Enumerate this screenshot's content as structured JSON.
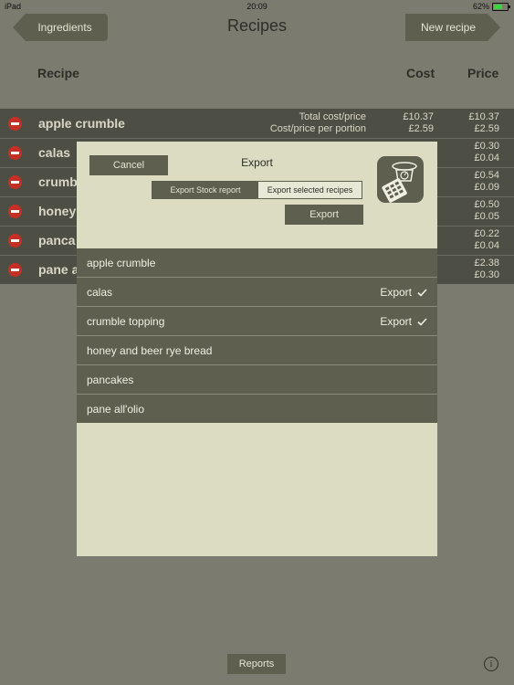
{
  "status": {
    "device": "iPad",
    "time": "20:09",
    "battery": "62%"
  },
  "nav": {
    "back_label": "Ingredients",
    "title": "Recipes",
    "new_label": "New recipe"
  },
  "columns": {
    "recipe": "Recipe",
    "cost": "Cost",
    "price": "Price"
  },
  "summary": {
    "total_label": "Total cost/price",
    "portion_label": "Cost/price per portion",
    "total_cost": "£10.37",
    "total_price": "£10.37",
    "portion_cost": "£2.59",
    "portion_price": "£2.59"
  },
  "rows": [
    {
      "name": "apple crumble",
      "cost1": "",
      "cost2": "",
      "price1": "",
      "price2": ""
    },
    {
      "name": "calas",
      "price1": "£0.30",
      "price2": "£0.04"
    },
    {
      "name": "crumb",
      "price1": "£0.54",
      "price2": "£0.09"
    },
    {
      "name": "honey",
      "price1": "£0.50",
      "price2": "£0.05"
    },
    {
      "name": "panca",
      "price1": "£0.22",
      "price2": "£0.04"
    },
    {
      "name": "pane a",
      "price1": "£2.38",
      "price2": "£0.30"
    }
  ],
  "dialog": {
    "cancel_label": "Cancel",
    "title": "Export",
    "seg_stock": "Export Stock report",
    "seg_selected": "Export selected recipes",
    "export_label": "Export",
    "items": [
      {
        "name": "apple crumble",
        "mark": ""
      },
      {
        "name": "calas",
        "mark": "Export"
      },
      {
        "name": "crumble topping",
        "mark": "Export"
      },
      {
        "name": "honey and beer rye bread",
        "mark": ""
      },
      {
        "name": "pancakes",
        "mark": ""
      },
      {
        "name": "pane all'olio",
        "mark": ""
      }
    ]
  },
  "bottom": {
    "reports_label": "Reports",
    "info_glyph": "i"
  }
}
